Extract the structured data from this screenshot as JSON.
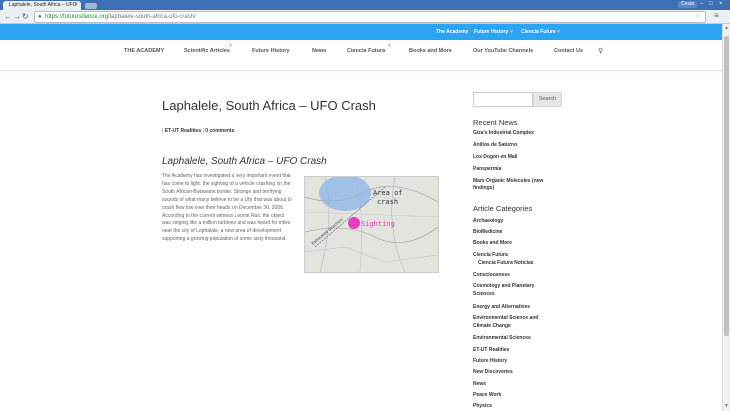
{
  "browser": {
    "tab_title": "Laphalele, South Africa – UFO",
    "tab_close": "×",
    "user": "Cesar",
    "window_controls": [
      "–",
      "□",
      "×"
    ],
    "url_host": "https://futuresdence.org",
    "url_path": "/laphalele-south-africa-ufo-crash/"
  },
  "topbar": {
    "links": [
      "The Academy",
      "Future History",
      "Ciencia Future"
    ]
  },
  "header": {
    "nav": [
      "THE ACADEMY",
      "Scientific Articles",
      "Future History",
      "News",
      "Ciencia Futura",
      "Books and More",
      "Our YouTube Channels",
      "Contact Us"
    ]
  },
  "article": {
    "title": "Laphalele, South Africa – UFO Crash",
    "meta_author": "ET-UT Realities",
    "meta_sep": "|",
    "meta_comments": "0 comments",
    "subtitle": "Laphalele, South Africa – UFO Crash",
    "body": "The Academy has investigated a very important event that has come to light: the sighting of a vehicle crashing on the South African-Botswana border. Strange and terrifying sounds of what many believe to be a Ufo that was about to crash flew low over their heads on December 30, 2006. According to the current witness Leonie Ras, the object was singing like a million turbines and was heard for miles near the city of Lephalale, a new area of development supporting a growing population of some sixty thousand.",
    "map": {
      "area_label": "Area of crash",
      "sighting_label": "Sighting",
      "path_label": "Estimated direction",
      "area_color": "#8ab6e8",
      "sighting_color": "#e040c0"
    }
  },
  "sidebar": {
    "search_button": "Search",
    "recent_heading": "Recent News",
    "recent": [
      "Giza's Industrial Complex",
      "Anillos de Saturno",
      "Los Dogon en Mali",
      "Panspermia",
      "Mars Organic Molecules (new",
      "findings)"
    ],
    "categories_heading": "Article Categories",
    "categories": [
      "Archaeology",
      "BioMedicine",
      "Books and More",
      "Ciencia Futura",
      "Ciencia Futura Noticias",
      "Consciousness",
      "Cosmology and Planetary",
      "Sciences",
      "Energy and Alternatives",
      "Environmental Science and",
      "Climate Change",
      "Environmental Sciences",
      "ET-UT Realities",
      "Future History",
      "New Discoveries",
      "News",
      "Peace Work",
      "Physics"
    ]
  },
  "icons": {
    "back": "←",
    "forward": "→",
    "reload": "↻",
    "lock": "🔒",
    "star": "☆",
    "menu": "≡",
    "search": "⚲",
    "chevron": "˅"
  },
  "colors": {
    "accent": "#2ea3f2",
    "chrome": "#3d6fb4"
  }
}
